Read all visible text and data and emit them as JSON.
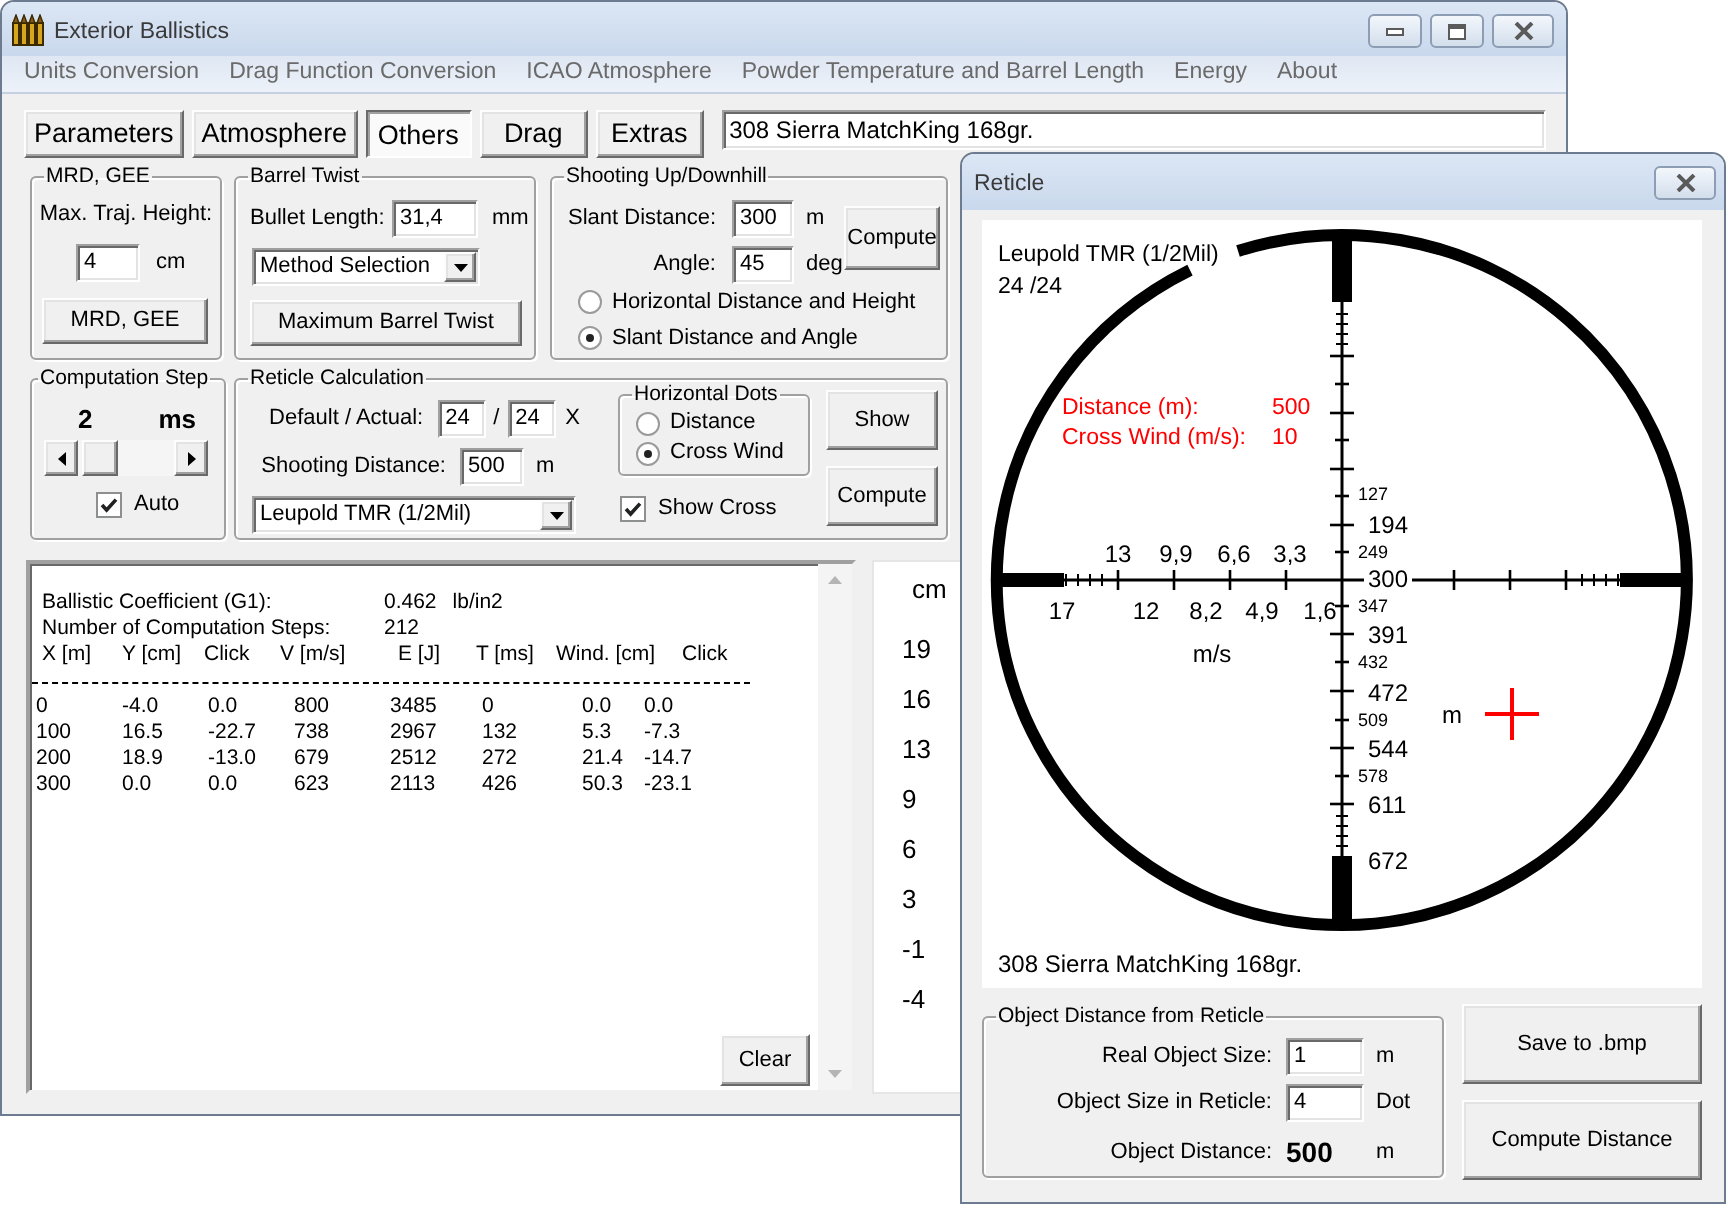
{
  "main_window": {
    "title": "Exterior Ballistics",
    "menu": [
      "Units Conversion",
      "Drag Function Conversion",
      "ICAO Atmosphere",
      "Powder Temperature and Barrel Length",
      "Energy",
      "About"
    ],
    "tabs": [
      {
        "label": "Parameters",
        "selected": false
      },
      {
        "label": "Atmosphere",
        "selected": false
      },
      {
        "label": "Others",
        "selected": true
      },
      {
        "label": "Drag",
        "selected": false
      },
      {
        "label": "Extras",
        "selected": false
      }
    ],
    "projectile": "308 Sierra MatchKing 168gr.",
    "mrd_gee": {
      "title": "MRD, GEE",
      "label": "Max. Traj. Height:",
      "value": "4",
      "unit": "cm",
      "button": "MRD, GEE"
    },
    "barrel_twist": {
      "title": "Barrel Twist",
      "label": "Bullet Length:",
      "value": "31,4",
      "unit": "mm",
      "method": "Method Selection",
      "button": "Maximum Barrel Twist"
    },
    "shooting_up_downhill": {
      "title": "Shooting Up/Downhill",
      "fields": [
        {
          "label": "Slant Distance:",
          "value": "300",
          "unit": "m"
        },
        {
          "label": "Angle:",
          "value": "45",
          "unit": "deg"
        }
      ],
      "button": "Compute",
      "options": [
        {
          "label": "Horizontal Distance and Height",
          "selected": false
        },
        {
          "label": "Slant Distance and Angle",
          "selected": true
        }
      ]
    },
    "computation_step": {
      "title": "Computation Step",
      "value": "2",
      "unit": "ms",
      "level": 0.05,
      "auto": {
        "label": "Auto",
        "checked": true
      }
    },
    "reticle_calculation": {
      "title": "Reticle Calculation",
      "magnification_label": "Default / Actual:",
      "default": "24",
      "separator": "/",
      "actual": "24",
      "suffix": "X",
      "distance_label": "Shooting Distance:",
      "distance": "500",
      "distance_unit": "m",
      "reticle": "Leupold TMR (1/2Mil)",
      "horizontal_dots": {
        "title": "Horizontal Dots",
        "options": [
          {
            "label": "Distance",
            "selected": false
          },
          {
            "label": "Cross Wind",
            "selected": true
          }
        ]
      },
      "show_cross": {
        "label": "Show Cross",
        "checked": true
      },
      "buttons": [
        "Show",
        "Compute"
      ]
    },
    "results": {
      "info": [
        {
          "label": "Ballistic Coefficient (G1):",
          "value": "0.462",
          "unit": "lb/in2"
        },
        {
          "label": "Number of Computation Steps:",
          "value": "212"
        }
      ],
      "columns": [
        "X [m]",
        "Y [cm]",
        "Click",
        "V [m/s]",
        "E [J]",
        "T [ms]",
        "Wind. [cm]",
        "Click"
      ],
      "rows": [
        [
          "0",
          "-4.0",
          "0.0",
          "800",
          "3485",
          "0",
          "0.0",
          "0.0"
        ],
        [
          "100",
          "16.5",
          "-22.7",
          "738",
          "2967",
          "132",
          "5.3",
          "-7.3"
        ],
        [
          "200",
          "18.9",
          "-13.0",
          "679",
          "2512",
          "272",
          "21.4",
          "-14.7"
        ],
        [
          "300",
          "0.0",
          "0.0",
          "623",
          "2113",
          "426",
          "50.3",
          "-23.1"
        ]
      ],
      "button": "Clear"
    },
    "scale": {
      "unit": "cm",
      "values": [
        "19",
        "16",
        "13",
        "9",
        "6",
        "3",
        "-1",
        "-4"
      ]
    }
  },
  "reticle_window": {
    "title": "Reticle",
    "reticle": {
      "name": "Leupold TMR (1/2Mil)",
      "magnification": "24 /24",
      "readouts": [
        {
          "label": "Distance (m):",
          "value": "500"
        },
        {
          "label": "Cross Wind (m/s):",
          "value": "10"
        }
      ],
      "distance_scale": [
        {
          "text": "127",
          "kind": "minor"
        },
        {
          "text": "194",
          "kind": "major"
        },
        {
          "text": "249",
          "kind": "minor"
        },
        {
          "text": "300",
          "kind": "major"
        },
        {
          "text": "347",
          "kind": "minor"
        },
        {
          "text": "391",
          "kind": "major"
        },
        {
          "text": "432",
          "kind": "minor"
        },
        {
          "text": "472",
          "kind": "major"
        },
        {
          "text": "509",
          "kind": "minor"
        },
        {
          "text": "544",
          "kind": "major"
        },
        {
          "text": "578",
          "kind": "minor"
        },
        {
          "text": "611",
          "kind": "major"
        },
        {
          "text": "672",
          "kind": "major"
        }
      ],
      "wind_scale_upper": [
        "13",
        "9,9",
        "6,6",
        "3,3"
      ],
      "wind_scale_lower": [
        "17",
        "12",
        "8,2",
        "4,9",
        "1,6"
      ],
      "wind_unit": "m/s",
      "cross_unit": "m",
      "projectile": "308 Sierra MatchKing 168gr."
    },
    "object_distance": {
      "title": "Object Distance from Reticle",
      "fields": [
        {
          "label": "Real Object Size:",
          "value": "1",
          "unit": "m"
        },
        {
          "label": "Object Size in Reticle:",
          "value": "4",
          "unit": "Dot"
        }
      ],
      "result_label": "Object Distance:",
      "result": "500",
      "result_unit": "m"
    },
    "buttons": [
      "Save to .bmp",
      "Compute Distance"
    ]
  }
}
